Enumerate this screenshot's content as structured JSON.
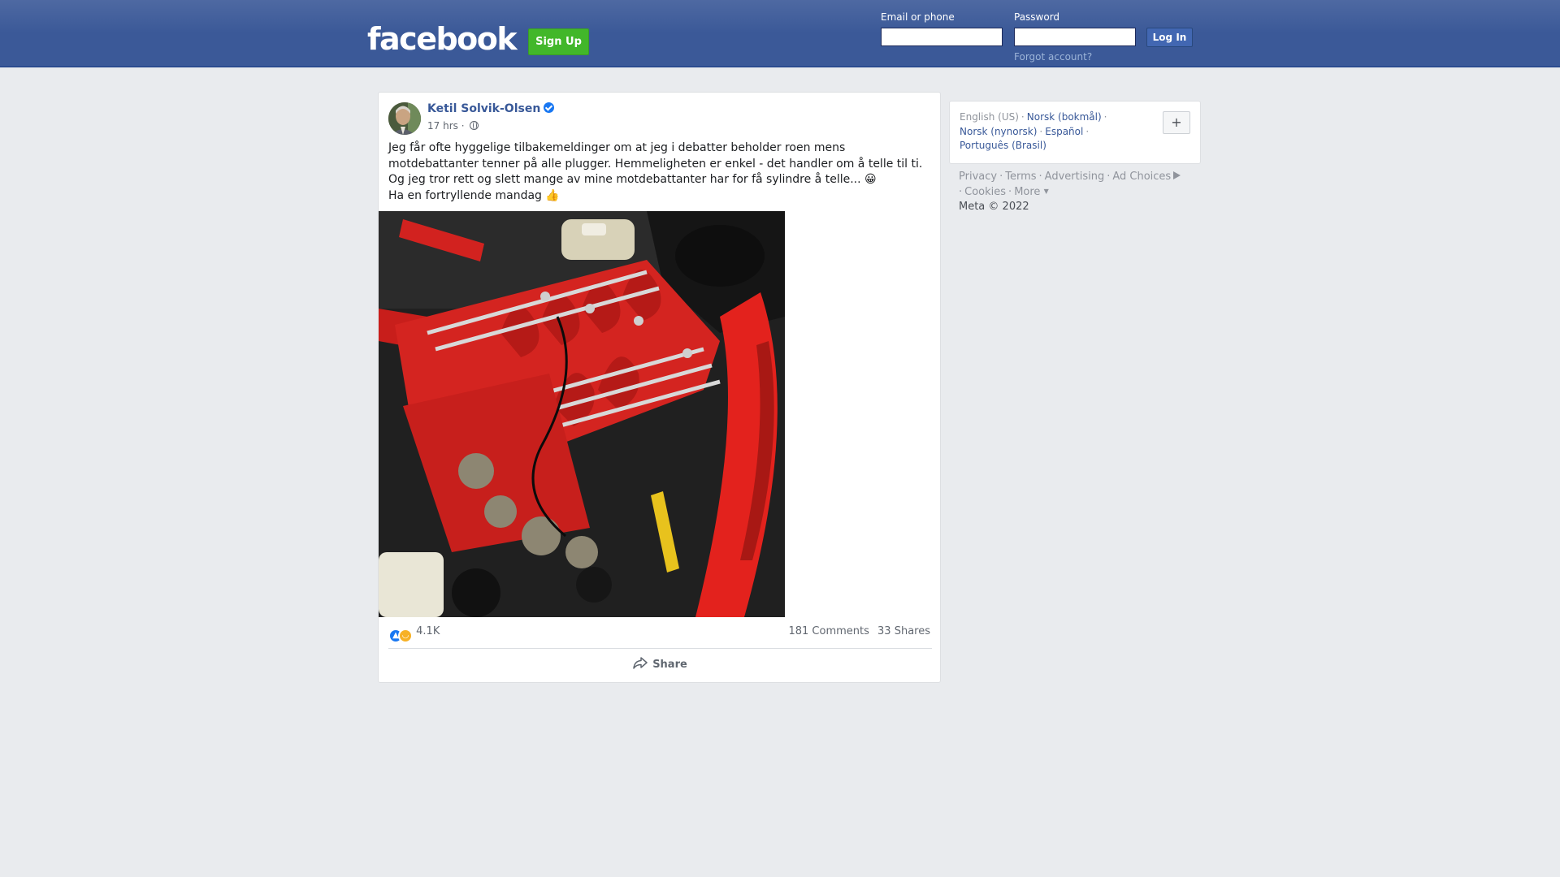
{
  "header": {
    "logo": "facebook",
    "signup_label": "Sign Up",
    "email_label": "Email or phone",
    "email_value": "",
    "password_label": "Password",
    "password_value": "",
    "login_label": "Log In",
    "forgot_label": "Forgot account?"
  },
  "post": {
    "author": "Ketil Solvik-Olsen",
    "time": "17 hrs",
    "time_sep": "·",
    "text_lines": [
      "Jeg får ofte hyggelige tilbakemeldinger om at jeg i debatter beholder roen mens",
      "motdebattanter tenner på alle plugger. Hemmeligheten er enkel - det handler om å telle til ti.",
      "Og jeg tror rett og slett mange av mine motdebattanter har for få sylindre å telle... 😀",
      "Ha en fortryllende mandag 👍"
    ],
    "reaction_count": "4.1K",
    "comments": "181 Comments",
    "shares": "33 Shares",
    "share_label": "Share"
  },
  "languages": {
    "current": "English (US)",
    "items": [
      "Norsk (bokmål)",
      "Norsk (nynorsk)",
      "Español",
      "Português (Brasil)"
    ],
    "add_label": "+"
  },
  "footer": {
    "links": [
      "Privacy",
      "Terms",
      "Advertising",
      "Ad Choices",
      "Cookies",
      "More"
    ],
    "copyright": "Meta © 2022"
  },
  "icons": {
    "verified": "verified-badge-icon",
    "privacy": "globe-icon",
    "like": "like-reaction-icon",
    "haha": "haha-reaction-icon",
    "share": "share-arrow-icon"
  },
  "colors": {
    "brand_blue": "#3b5998",
    "signup_green": "#42b72a",
    "link_blue": "#385898",
    "page_bg": "#e9ebee"
  }
}
